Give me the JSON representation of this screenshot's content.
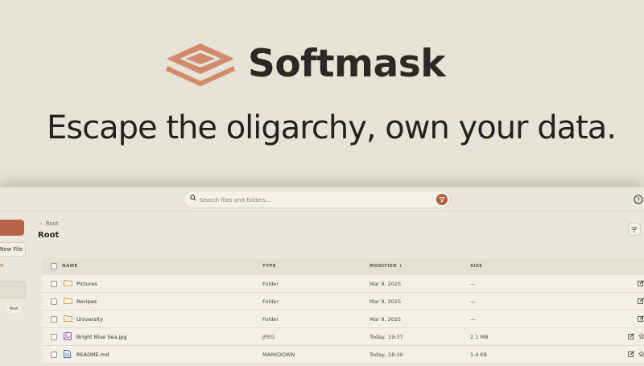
{
  "hero": {
    "brand": "Softmask",
    "tagline": "Escape the oligarchy, own your data.",
    "logo_color": "#d28a6d"
  },
  "topbar": {
    "search_placeholder": "Search files and folders...",
    "filter_color": "#b35f3c"
  },
  "sidebar": {
    "new_file_label": "New File",
    "red_text": "n",
    "new_badge": "New",
    "accent": "#b5664a"
  },
  "main": {
    "breadcrumb": "Root",
    "title": "Root",
    "columns": [
      "NAME",
      "TYPE",
      "MODIFIED ↓",
      "SIZE"
    ],
    "rows": [
      {
        "name": "Pictures",
        "type": "Folder",
        "modified": "Mar 9, 2025",
        "size": "—",
        "icon": "folder-icon"
      },
      {
        "name": "Recipes",
        "type": "Folder",
        "modified": "Mar 9, 2025",
        "size": "—",
        "icon": "folder-icon"
      },
      {
        "name": "University",
        "type": "Folder",
        "modified": "Mar 9, 2025",
        "size": "—",
        "icon": "folder-icon"
      },
      {
        "name": "Bright Blue Sea.jpg",
        "type": "JPEG",
        "modified": "Today, 19:37",
        "size": "2.1 MB",
        "icon": "image-file-icon"
      },
      {
        "name": "README.md",
        "type": "MARKDOWN",
        "modified": "Today, 18:30",
        "size": "1.4 KB",
        "icon": "document-file-icon"
      }
    ]
  }
}
